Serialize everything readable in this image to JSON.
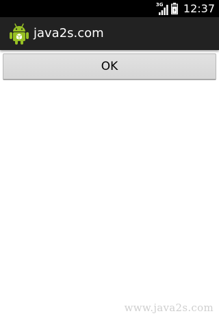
{
  "status_bar": {
    "network_label": "3G",
    "time": "12:37",
    "icons": [
      "3g-signal-icon",
      "battery-icon"
    ]
  },
  "action_bar": {
    "app_icon": "android-robot-icon",
    "title": "java2s.com"
  },
  "main": {
    "ok_button_label": "OK"
  },
  "watermark": "www.java2s.com",
  "colors": {
    "status_bar_bg": "#000000",
    "action_bar_bg": "#222222",
    "android_green": "#97c024",
    "button_bg": "#d9d9d9",
    "page_bg": "#ffffff"
  }
}
